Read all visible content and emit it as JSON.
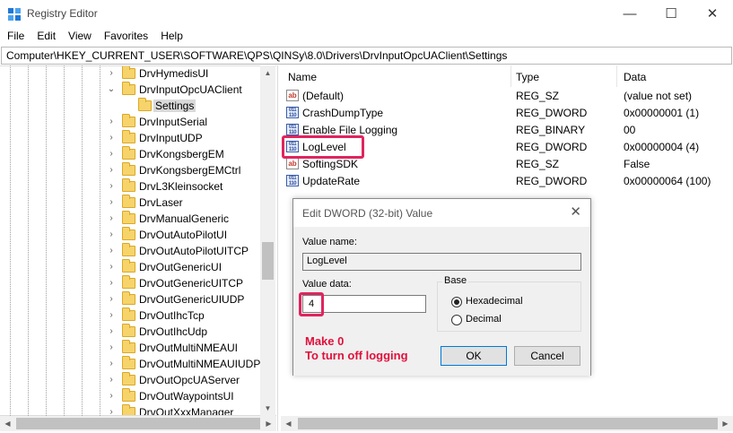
{
  "window": {
    "title": "Registry Editor"
  },
  "menu": [
    "File",
    "Edit",
    "View",
    "Favorites",
    "Help"
  ],
  "address": "Computer\\HKEY_CURRENT_USER\\SOFTWARE\\QPS\\QINSy\\8.0\\Drivers\\DrvInputOpcUAClient\\Settings",
  "tree": {
    "items": [
      {
        "label": "DrvHymedisUI",
        "expanded": false,
        "selected": false,
        "level": 0
      },
      {
        "label": "DrvInputOpcUAClient",
        "expanded": true,
        "selected": false,
        "level": 0
      },
      {
        "label": "Settings",
        "expanded": false,
        "selected": true,
        "level": 1
      },
      {
        "label": "DrvInputSerial",
        "expanded": false,
        "selected": false,
        "level": 0
      },
      {
        "label": "DrvInputUDP",
        "expanded": false,
        "selected": false,
        "level": 0
      },
      {
        "label": "DrvKongsbergEM",
        "expanded": false,
        "selected": false,
        "level": 0
      },
      {
        "label": "DrvKongsbergEMCtrl",
        "expanded": false,
        "selected": false,
        "level": 0
      },
      {
        "label": "DrvL3Kleinsocket",
        "expanded": false,
        "selected": false,
        "level": 0
      },
      {
        "label": "DrvLaser",
        "expanded": false,
        "selected": false,
        "level": 0
      },
      {
        "label": "DrvManualGeneric",
        "expanded": false,
        "selected": false,
        "level": 0
      },
      {
        "label": "DrvOutAutoPilotUI",
        "expanded": false,
        "selected": false,
        "level": 0
      },
      {
        "label": "DrvOutAutoPilotUITCP",
        "expanded": false,
        "selected": false,
        "level": 0
      },
      {
        "label": "DrvOutGenericUI",
        "expanded": false,
        "selected": false,
        "level": 0
      },
      {
        "label": "DrvOutGenericUITCP",
        "expanded": false,
        "selected": false,
        "level": 0
      },
      {
        "label": "DrvOutGenericUIUDP",
        "expanded": false,
        "selected": false,
        "level": 0
      },
      {
        "label": "DrvOutIhcTcp",
        "expanded": false,
        "selected": false,
        "level": 0
      },
      {
        "label": "DrvOutIhcUdp",
        "expanded": false,
        "selected": false,
        "level": 0
      },
      {
        "label": "DrvOutMultiNMEAUI",
        "expanded": false,
        "selected": false,
        "level": 0
      },
      {
        "label": "DrvOutMultiNMEAUIUDP",
        "expanded": false,
        "selected": false,
        "level": 0
      },
      {
        "label": "DrvOutOpcUAServer",
        "expanded": false,
        "selected": false,
        "level": 0
      },
      {
        "label": "DrvOutWaypointsUI",
        "expanded": false,
        "selected": false,
        "level": 0
      },
      {
        "label": "DrvOutXxxManager",
        "expanded": false,
        "selected": false,
        "level": 0
      }
    ]
  },
  "list": {
    "columns": [
      "Name",
      "Type",
      "Data"
    ],
    "rows": [
      {
        "name": "(Default)",
        "type": "REG_SZ",
        "data": "(value not set)",
        "icon": "string-value-icon"
      },
      {
        "name": "CrashDumpType",
        "type": "REG_DWORD",
        "data": "0x00000001 (1)",
        "icon": "binary-value-icon"
      },
      {
        "name": "Enable File Logging",
        "type": "REG_BINARY",
        "data": "00",
        "icon": "binary-value-icon"
      },
      {
        "name": "LogLevel",
        "type": "REG_DWORD",
        "data": "0x00000004 (4)",
        "icon": "binary-value-icon"
      },
      {
        "name": "SoftingSDK",
        "type": "REG_SZ",
        "data": "False",
        "icon": "string-value-icon"
      },
      {
        "name": "UpdateRate",
        "type": "REG_DWORD",
        "data": "0x00000064 (100)",
        "icon": "binary-value-icon"
      }
    ]
  },
  "dialog": {
    "title": "Edit DWORD (32-bit) Value",
    "value_name_label": "Value name:",
    "value_name": "LogLevel",
    "value_data_label": "Value data:",
    "value_data": "4",
    "base_label": "Base",
    "hex_label": "Hexadecimal",
    "dec_label": "Decimal",
    "base_selected": "Hexadecimal",
    "ok_label": "OK",
    "cancel_label": "Cancel"
  },
  "annotation": {
    "line1": "Make 0",
    "line2": "To turn off logging",
    "color": "#e0103c",
    "highlight_color": "#e0245e"
  }
}
